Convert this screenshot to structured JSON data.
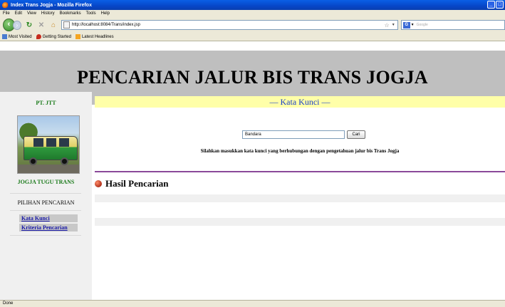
{
  "window": {
    "title": "Index Trans Jogja - Mozilla Firefox",
    "controls": [
      "minimize",
      "maximize"
    ]
  },
  "menubar": {
    "items": [
      "File",
      "Edit",
      "View",
      "History",
      "Bookmarks",
      "Tools",
      "Help"
    ]
  },
  "navbar": {
    "url": "http://localhost:8084/Trans/index.jsp",
    "search_engine": "G",
    "search_placeholder": "Google"
  },
  "bookmarks": {
    "items": [
      "Most Visited",
      "Getting Started",
      "Latest Headlines"
    ]
  },
  "page": {
    "header_title": "PENCARIAN JALUR BIS TRANS JOGJA",
    "sidebar": {
      "company": "PT. JTT",
      "subtitle": "JOGJA TUGU TRANS",
      "section_title": "PILIHAN PENCARIAN",
      "links": [
        "Kata Kunci",
        "Kriteria Pencarian"
      ]
    },
    "main": {
      "section_heading": "— Kata Kunci —",
      "search_value": "Bandara",
      "search_button": "Cari",
      "hint": "Silahkan masukkan kata kunci yang berhubungan dengan pengetahuan jalur bis Trans Jogja",
      "results_heading": "Hasil Pencarian"
    }
  },
  "status": {
    "text": "Done"
  },
  "colors": {
    "header_bg": "#bfbfbf",
    "sidebar_bg": "#f0f0f0",
    "accent_green": "#1a7a1a",
    "heading_blue": "#1a3fc8",
    "heading_bg": "#ffffa8",
    "divider_purple": "#8a4a9a"
  }
}
